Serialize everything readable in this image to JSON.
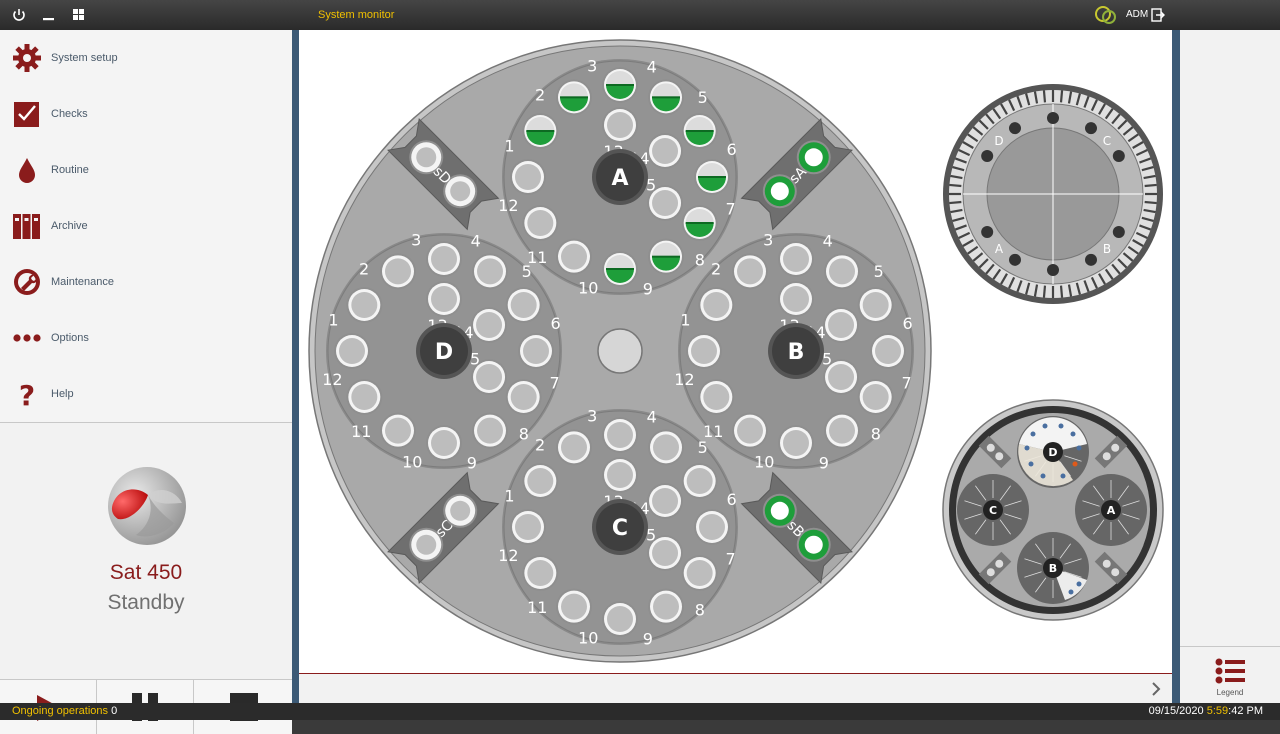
{
  "titlebar": {
    "title": "System monitor",
    "user": "ADM"
  },
  "sidebar": {
    "items": [
      {
        "label": "System setup",
        "icon": "gear-icon"
      },
      {
        "label": "Checks",
        "icon": "checkbox-icon"
      },
      {
        "label": "Routine",
        "icon": "blood-drop-icon"
      },
      {
        "label": "Archive",
        "icon": "archive-icon"
      },
      {
        "label": "Maintenance",
        "icon": "maintenance-icon"
      },
      {
        "label": "Options",
        "icon": "dots-icon"
      },
      {
        "label": "Help",
        "icon": "question-icon"
      }
    ],
    "model": "Sat 450",
    "state": "Standby"
  },
  "controls": [
    "play-icon",
    "pause-icon",
    "stop-icon"
  ],
  "carousel": {
    "groups": [
      {
        "label": "A",
        "filled": [
          1,
          2,
          3,
          4,
          5,
          6,
          7,
          8,
          9
        ]
      },
      {
        "label": "B",
        "filled": []
      },
      {
        "label": "C",
        "filled": []
      },
      {
        "label": "D",
        "filled": []
      }
    ],
    "position_labels": [
      "1",
      "2",
      "3",
      "4",
      "5",
      "6",
      "7",
      "8",
      "9",
      "10",
      "11",
      "12",
      "13",
      "14",
      "15"
    ],
    "side_slots": [
      {
        "label": "sA",
        "filled": true
      },
      {
        "label": "sB",
        "filled": true
      },
      {
        "label": "sC",
        "filled": false
      },
      {
        "label": "sD",
        "filled": false
      }
    ]
  },
  "reagent_ring": {
    "quadrants": [
      "D",
      "C",
      "A",
      "B"
    ]
  },
  "mini_rotor": {
    "labels": [
      "D",
      "C",
      "A",
      "B"
    ]
  },
  "legend_label": "Legend",
  "status": {
    "ops_label": "Ongoing operations",
    "ops_count": "0",
    "date": "09/15/2020 ",
    "time_highlight": "5:59",
    "time_rest": ":42 PM"
  },
  "colors": {
    "accent": "#8a1c1c",
    "filled": "#1e9e3a",
    "highlight": "#f0c000"
  }
}
